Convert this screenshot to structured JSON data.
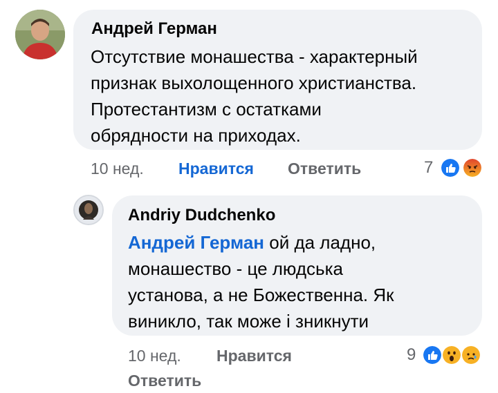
{
  "comment": {
    "author": "Андрей Герман",
    "lines": [
      "Отсутствие монашества - характерный",
      "признак выхолощенного христианства.",
      "Протестантизм с остатками",
      "обрядности на приходах."
    ],
    "time": "10 нед.",
    "like_label": "Нравится",
    "reply_label": "Ответить",
    "reaction_count": "7",
    "reactions": [
      "like-icon",
      "angry-icon"
    ]
  },
  "reply": {
    "author": "Andriy Dudchenko",
    "mention": "Андрей Герман",
    "lines": [
      "ой да ладно,",
      "монашество - це людська",
      "установа, а не Божественна. Як",
      "виникло, так може і зникнути"
    ],
    "time": "10 нед.",
    "like_label": "Нравится",
    "reply_label": "Ответить",
    "reaction_count": "9",
    "reactions": [
      "like-icon",
      "wow-icon",
      "sad-icon"
    ]
  },
  "colors": {
    "bubble": "#f0f2f5",
    "link": "#1467d4",
    "meta": "#65676b",
    "like": "#1877f2",
    "angry": "#e9710f",
    "haha": "#f7b125"
  }
}
